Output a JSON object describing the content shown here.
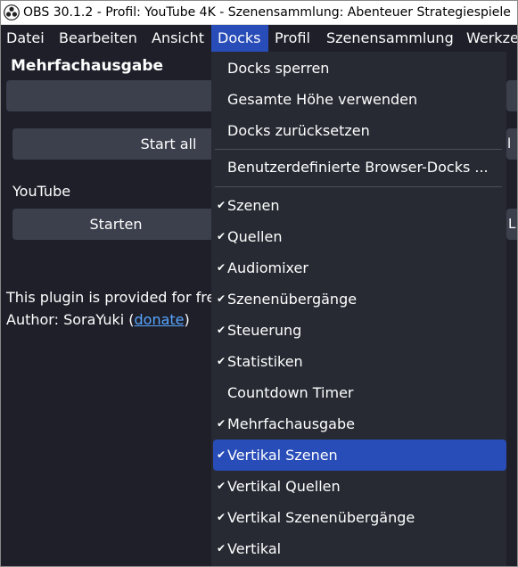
{
  "window": {
    "title": "OBS 30.1.2 - Profil: YouTube 4K - Szenensammlung: Abenteuer Strategiespiele"
  },
  "menubar": {
    "items": [
      "Datei",
      "Bearbeiten",
      "Ansicht",
      "Docks",
      "Profil",
      "Szenensammlung",
      "Werkze"
    ],
    "active": "Docks"
  },
  "dock": {
    "title": "Mehrfachausgabe",
    "start_all": "Start all",
    "youtube_label": "YouTube",
    "start_button": "Starten",
    "info_text": "This plugin is provided for fre",
    "author_prefix": "Author: SoraYuki (",
    "author_link": "donate",
    "author_suffix": ")"
  },
  "right_edge": {
    "btn1": "l",
    "btn2": "L"
  },
  "docks_menu": {
    "group1": [
      "Docks sperren",
      "Gesamte Höhe verwenden",
      "Docks zurücksetzen"
    ],
    "group2": [
      "Benutzerdefinierte Browser-Docks ..."
    ],
    "docks": [
      {
        "label": "Szenen",
        "checked": true
      },
      {
        "label": "Quellen",
        "checked": true
      },
      {
        "label": "Audiomixer",
        "checked": true
      },
      {
        "label": "Szenenübergänge",
        "checked": true
      },
      {
        "label": "Steuerung",
        "checked": true
      },
      {
        "label": "Statistiken",
        "checked": true
      },
      {
        "label": "Countdown Timer",
        "checked": false
      },
      {
        "label": "Mehrfachausgabe",
        "checked": true
      },
      {
        "label": "Vertikal Szenen",
        "checked": true,
        "highlighted": true
      },
      {
        "label": "Vertikal Quellen",
        "checked": true
      },
      {
        "label": "Vertikal Szenenübergänge",
        "checked": true
      },
      {
        "label": "Vertikal",
        "checked": true
      }
    ],
    "check_glyph": "✔"
  },
  "colors": {
    "background": "#1e1f29",
    "menu": "#272a33",
    "accent": "#284cb8",
    "button": "#3c404d",
    "link": "#58a6ff"
  }
}
